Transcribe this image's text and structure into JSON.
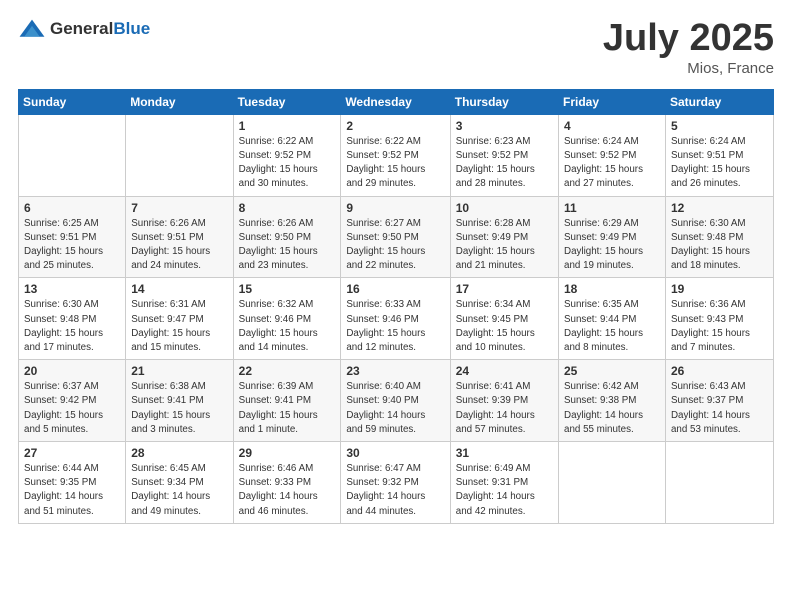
{
  "header": {
    "logo_general": "General",
    "logo_blue": "Blue",
    "month_year": "July 2025",
    "location": "Mios, France"
  },
  "days_of_week": [
    "Sunday",
    "Monday",
    "Tuesday",
    "Wednesday",
    "Thursday",
    "Friday",
    "Saturday"
  ],
  "weeks": [
    [
      {
        "day": "",
        "info": ""
      },
      {
        "day": "",
        "info": ""
      },
      {
        "day": "1",
        "info": "Sunrise: 6:22 AM\nSunset: 9:52 PM\nDaylight: 15 hours\nand 30 minutes."
      },
      {
        "day": "2",
        "info": "Sunrise: 6:22 AM\nSunset: 9:52 PM\nDaylight: 15 hours\nand 29 minutes."
      },
      {
        "day": "3",
        "info": "Sunrise: 6:23 AM\nSunset: 9:52 PM\nDaylight: 15 hours\nand 28 minutes."
      },
      {
        "day": "4",
        "info": "Sunrise: 6:24 AM\nSunset: 9:52 PM\nDaylight: 15 hours\nand 27 minutes."
      },
      {
        "day": "5",
        "info": "Sunrise: 6:24 AM\nSunset: 9:51 PM\nDaylight: 15 hours\nand 26 minutes."
      }
    ],
    [
      {
        "day": "6",
        "info": "Sunrise: 6:25 AM\nSunset: 9:51 PM\nDaylight: 15 hours\nand 25 minutes."
      },
      {
        "day": "7",
        "info": "Sunrise: 6:26 AM\nSunset: 9:51 PM\nDaylight: 15 hours\nand 24 minutes."
      },
      {
        "day": "8",
        "info": "Sunrise: 6:26 AM\nSunset: 9:50 PM\nDaylight: 15 hours\nand 23 minutes."
      },
      {
        "day": "9",
        "info": "Sunrise: 6:27 AM\nSunset: 9:50 PM\nDaylight: 15 hours\nand 22 minutes."
      },
      {
        "day": "10",
        "info": "Sunrise: 6:28 AM\nSunset: 9:49 PM\nDaylight: 15 hours\nand 21 minutes."
      },
      {
        "day": "11",
        "info": "Sunrise: 6:29 AM\nSunset: 9:49 PM\nDaylight: 15 hours\nand 19 minutes."
      },
      {
        "day": "12",
        "info": "Sunrise: 6:30 AM\nSunset: 9:48 PM\nDaylight: 15 hours\nand 18 minutes."
      }
    ],
    [
      {
        "day": "13",
        "info": "Sunrise: 6:30 AM\nSunset: 9:48 PM\nDaylight: 15 hours\nand 17 minutes."
      },
      {
        "day": "14",
        "info": "Sunrise: 6:31 AM\nSunset: 9:47 PM\nDaylight: 15 hours\nand 15 minutes."
      },
      {
        "day": "15",
        "info": "Sunrise: 6:32 AM\nSunset: 9:46 PM\nDaylight: 15 hours\nand 14 minutes."
      },
      {
        "day": "16",
        "info": "Sunrise: 6:33 AM\nSunset: 9:46 PM\nDaylight: 15 hours\nand 12 minutes."
      },
      {
        "day": "17",
        "info": "Sunrise: 6:34 AM\nSunset: 9:45 PM\nDaylight: 15 hours\nand 10 minutes."
      },
      {
        "day": "18",
        "info": "Sunrise: 6:35 AM\nSunset: 9:44 PM\nDaylight: 15 hours\nand 8 minutes."
      },
      {
        "day": "19",
        "info": "Sunrise: 6:36 AM\nSunset: 9:43 PM\nDaylight: 15 hours\nand 7 minutes."
      }
    ],
    [
      {
        "day": "20",
        "info": "Sunrise: 6:37 AM\nSunset: 9:42 PM\nDaylight: 15 hours\nand 5 minutes."
      },
      {
        "day": "21",
        "info": "Sunrise: 6:38 AM\nSunset: 9:41 PM\nDaylight: 15 hours\nand 3 minutes."
      },
      {
        "day": "22",
        "info": "Sunrise: 6:39 AM\nSunset: 9:41 PM\nDaylight: 15 hours\nand 1 minute."
      },
      {
        "day": "23",
        "info": "Sunrise: 6:40 AM\nSunset: 9:40 PM\nDaylight: 14 hours\nand 59 minutes."
      },
      {
        "day": "24",
        "info": "Sunrise: 6:41 AM\nSunset: 9:39 PM\nDaylight: 14 hours\nand 57 minutes."
      },
      {
        "day": "25",
        "info": "Sunrise: 6:42 AM\nSunset: 9:38 PM\nDaylight: 14 hours\nand 55 minutes."
      },
      {
        "day": "26",
        "info": "Sunrise: 6:43 AM\nSunset: 9:37 PM\nDaylight: 14 hours\nand 53 minutes."
      }
    ],
    [
      {
        "day": "27",
        "info": "Sunrise: 6:44 AM\nSunset: 9:35 PM\nDaylight: 14 hours\nand 51 minutes."
      },
      {
        "day": "28",
        "info": "Sunrise: 6:45 AM\nSunset: 9:34 PM\nDaylight: 14 hours\nand 49 minutes."
      },
      {
        "day": "29",
        "info": "Sunrise: 6:46 AM\nSunset: 9:33 PM\nDaylight: 14 hours\nand 46 minutes."
      },
      {
        "day": "30",
        "info": "Sunrise: 6:47 AM\nSunset: 9:32 PM\nDaylight: 14 hours\nand 44 minutes."
      },
      {
        "day": "31",
        "info": "Sunrise: 6:49 AM\nSunset: 9:31 PM\nDaylight: 14 hours\nand 42 minutes."
      },
      {
        "day": "",
        "info": ""
      },
      {
        "day": "",
        "info": ""
      }
    ]
  ]
}
